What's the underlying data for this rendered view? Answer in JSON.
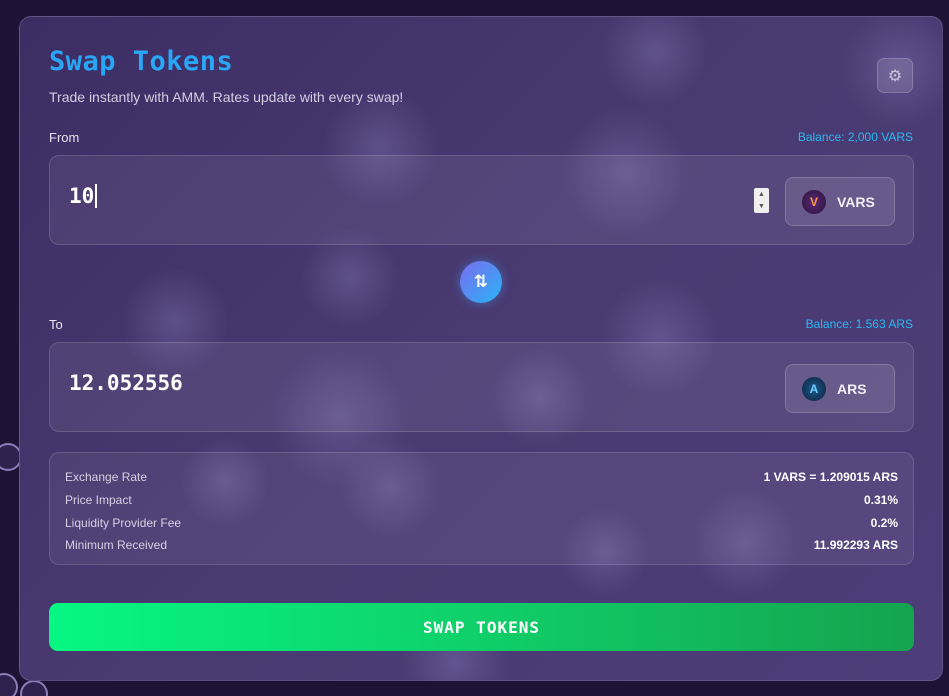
{
  "header": {
    "title": "Swap Tokens",
    "subtitle": "Trade instantly with AMM. Rates update with every swap!",
    "settings_icon": "gear-icon"
  },
  "from": {
    "label": "From",
    "balance": "Balance: 2,000 VARS",
    "amount": "10",
    "token": "VARS"
  },
  "swap_direction_icon": "swap-arrows-icon",
  "to": {
    "label": "To",
    "balance": "Balance: 1.563 ARS",
    "amount": "12.052556",
    "token": "ARS"
  },
  "details": [
    {
      "key": "Exchange Rate",
      "value": "1 VARS = 1.209015 ARS"
    },
    {
      "key": "Price Impact",
      "value": "0.31%"
    },
    {
      "key": "Liquidity Provider Fee",
      "value": "0.2%"
    },
    {
      "key": "Minimum Received",
      "value": "11.992293 ARS"
    }
  ],
  "swap_button": "SWAP TOKENS",
  "colors": {
    "title": "#2aa6f7",
    "balance": "#27b9f3",
    "swap_button_start": "#06f782",
    "swap_button_end": "#15a34e"
  }
}
